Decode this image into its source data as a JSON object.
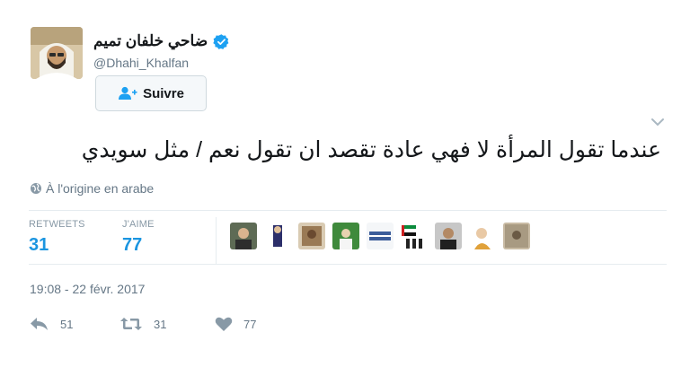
{
  "profile": {
    "display_name": "ضاحي خلفان تميم",
    "handle": "@Dhahi_Khalfan",
    "verified": true,
    "avatar_icon": "person-avatar-icon"
  },
  "follow_button": {
    "label": "Suivre",
    "icon": "add-user-icon"
  },
  "tweet": {
    "text": "عندما تقول المرأة لا فهي عادة تقصد ان تقول نعم / مثل سويدي",
    "translate_label": "À l'origine en arabe"
  },
  "stats": {
    "retweets_label": "RETWEETS",
    "retweets_value": "31",
    "likes_label": "J'AIME",
    "likes_value": "77",
    "liker_avatar_count": 9
  },
  "timestamp": "19:08 - 22 févr. 2017",
  "actions": {
    "reply_count": "51",
    "retweet_count": "31",
    "like_count": "77"
  },
  "colors": {
    "accent": "#1b95e0",
    "muted_text": "#657786",
    "verified_blue": "#1da1f2",
    "divider": "#e6ecf0"
  }
}
